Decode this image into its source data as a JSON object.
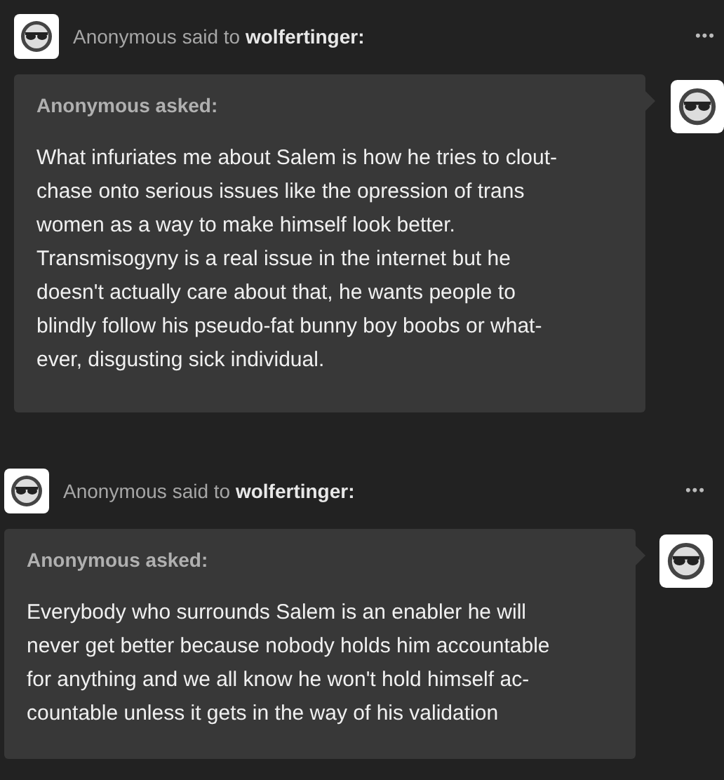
{
  "posts": [
    {
      "sender": "Anonymous",
      "said_to": "said to",
      "recipient": "wolfertinger:",
      "more": "•••",
      "asker": "Anonymous asked:",
      "question": "What infuriates me about Salem is how he tries to clout-\nchase onto serious issues like the opression of trans\nwomen as a way to make himself look better.\nTransmisogyny is a real issue in the internet but he\ndoesn't actually care about that, he wants people to\nblindly follow his pseudo-fat bunny boy boobs or what-\never, disgusting sick individual."
    },
    {
      "sender": "Anonymous",
      "said_to": "said to",
      "recipient": "wolfertinger:",
      "more": "•••",
      "asker": "Anonymous asked:",
      "question": "Everybody who surrounds Salem is an enabler he will\nnever get better because nobody holds him accountable\nfor anything and we all know he won't hold himself ac-\ncountable unless it gets in the way of his validation"
    }
  ]
}
